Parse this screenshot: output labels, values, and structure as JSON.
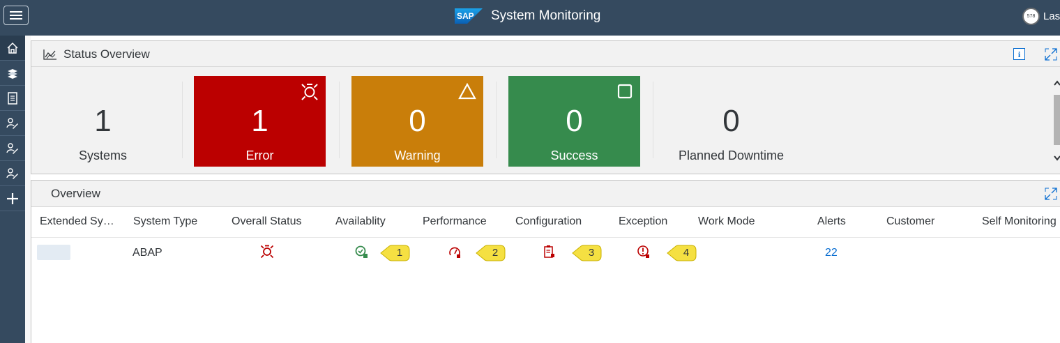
{
  "shell": {
    "title": "System Monitoring",
    "logo_text": "SAP",
    "user_badge": "578",
    "user_text_partial": "Las"
  },
  "left_nav": {
    "items": [
      "home-icon",
      "layers-icon",
      "document-icon",
      "edit-user-icon",
      "edit-user-icon",
      "edit-user-icon",
      "add-icon"
    ]
  },
  "status_overview": {
    "title": "Status Overview",
    "tiles": [
      {
        "value": "1",
        "label": "Systems",
        "color": "#f2f2f2"
      },
      {
        "value": "1",
        "label": "Error",
        "color": "#bb0000",
        "icon": "error-burst-icon"
      },
      {
        "value": "0",
        "label": "Warning",
        "color": "#c97e0a",
        "icon": "warning-triangle-icon"
      },
      {
        "value": "0",
        "label": "Success",
        "color": "#368b4d",
        "icon": "success-square-icon"
      },
      {
        "value": "0",
        "label": "Planned Downtime",
        "color": "#f2f2f2"
      }
    ]
  },
  "overview": {
    "title": "Overview",
    "columns": [
      "Extended Sy…",
      "System Type",
      "Overall Status",
      "Availablity",
      "Performance",
      "Configuration",
      "Exception",
      "Work Mode",
      "Alerts",
      "Customer",
      "Self Monitoring"
    ],
    "rows": [
      {
        "system_type": "ABAP",
        "overall_status_icon": "error-burst-icon",
        "availability_icon": "availability-ok-icon",
        "performance_icon": "performance-gauge-icon",
        "configuration_icon": "configuration-clipboard-icon",
        "exception_icon": "exception-alert-icon",
        "alerts": "22"
      }
    ],
    "callouts": [
      "1",
      "2",
      "3",
      "4"
    ]
  },
  "colors": {
    "shell": "#354a5f",
    "error": "#bb0000",
    "warning": "#c97e0a",
    "success": "#368b4d",
    "link": "#0a6ed1",
    "callout": "#f5e042"
  }
}
